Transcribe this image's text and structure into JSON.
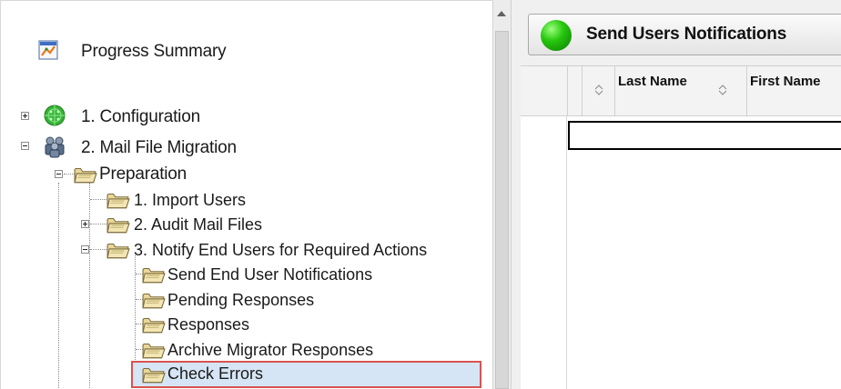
{
  "tree": {
    "progress_summary": "Progress Summary",
    "configuration": "1. Configuration",
    "mail_file_migration": "2. Mail File Migration",
    "preparation": "Preparation",
    "import_users": "1. Import Users",
    "audit_mail_files": "2. Audit Mail Files",
    "notify_end_users": "3. Notify End Users for Required Actions",
    "send_end_user_notifications": "Send End User Notifications",
    "pending_responses": "Pending Responses",
    "responses": "Responses",
    "archive_migrator_responses": "Archive Migrator Responses",
    "check_errors": "Check Errors"
  },
  "toolbar": {
    "send_label": "Send Users Notifications"
  },
  "grid": {
    "columns": [
      "Last Name",
      "First Name"
    ]
  },
  "colors": {
    "selection_border": "#d9534f",
    "selection_fill": "#d6e5f5",
    "status_green": "#27c80f"
  }
}
